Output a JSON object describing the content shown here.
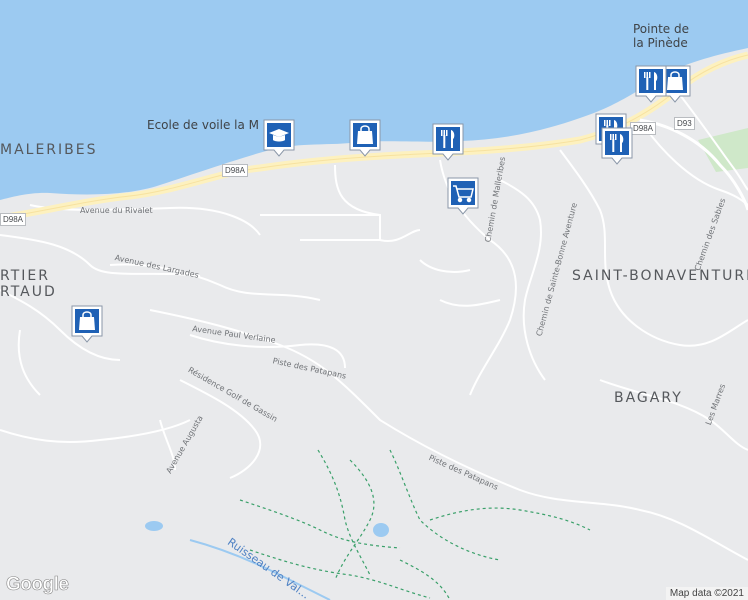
{
  "colors": {
    "water": "#9ccaf1",
    "land": "#e9eaec",
    "roads": "#ffffff",
    "main_road": "#fdf1bf",
    "trail": "#3aa06a",
    "pin_blue": "#1f61b5"
  },
  "districts": [
    "RTIER",
    "RTAUD",
    "MALERIBES",
    "SAINT-BONAVENTURE",
    "BAGARY"
  ],
  "places": {
    "sailing_school": "Ecole de voile la M",
    "pointe_line1": "Pointe de",
    "pointe_line2": "la Pinède"
  },
  "roads": {
    "route_d98a_1": "D98A",
    "route_d98a_2": "D98A",
    "route_d98a_3": "D98A",
    "route_d93": "D93",
    "rivalet": "Avenue du Rivalet",
    "largades": "Avenue des Largades",
    "verlaine": "Avenue Paul Verlaine",
    "patapans_1": "Piste des Patapans",
    "patapans_2": "Piste des Patapans",
    "gassin": "Résidence Golf de Gassin",
    "augusta": "Avenue Augusta",
    "malleribes": "Chemin de Malleribes",
    "sainte_bonne": "Chemin de Sainte-Bonne Aventure",
    "sables": "Chemin des Sables",
    "marres": "Les Marres",
    "valat": "Ruisseau de Val..."
  },
  "markers": [
    {
      "kind": "school",
      "icon": "graduation-cap-icon"
    },
    {
      "kind": "shopping",
      "icon": "shopping-bag-icon"
    },
    {
      "kind": "restaurant",
      "icon": "fork-knife-icon"
    },
    {
      "kind": "grocery",
      "icon": "shopping-cart-icon"
    },
    {
      "kind": "restaurant",
      "icon": "fork-knife-icon"
    },
    {
      "kind": "restaurant",
      "icon": "fork-knife-icon"
    },
    {
      "kind": "restaurant",
      "icon": "fork-knife-icon"
    },
    {
      "kind": "shopping",
      "icon": "shopping-bag-icon"
    },
    {
      "kind": "shopping",
      "icon": "shopping-bag-icon"
    }
  ],
  "branding": {
    "logo": "Google",
    "attribution": "Map data ©2021"
  }
}
